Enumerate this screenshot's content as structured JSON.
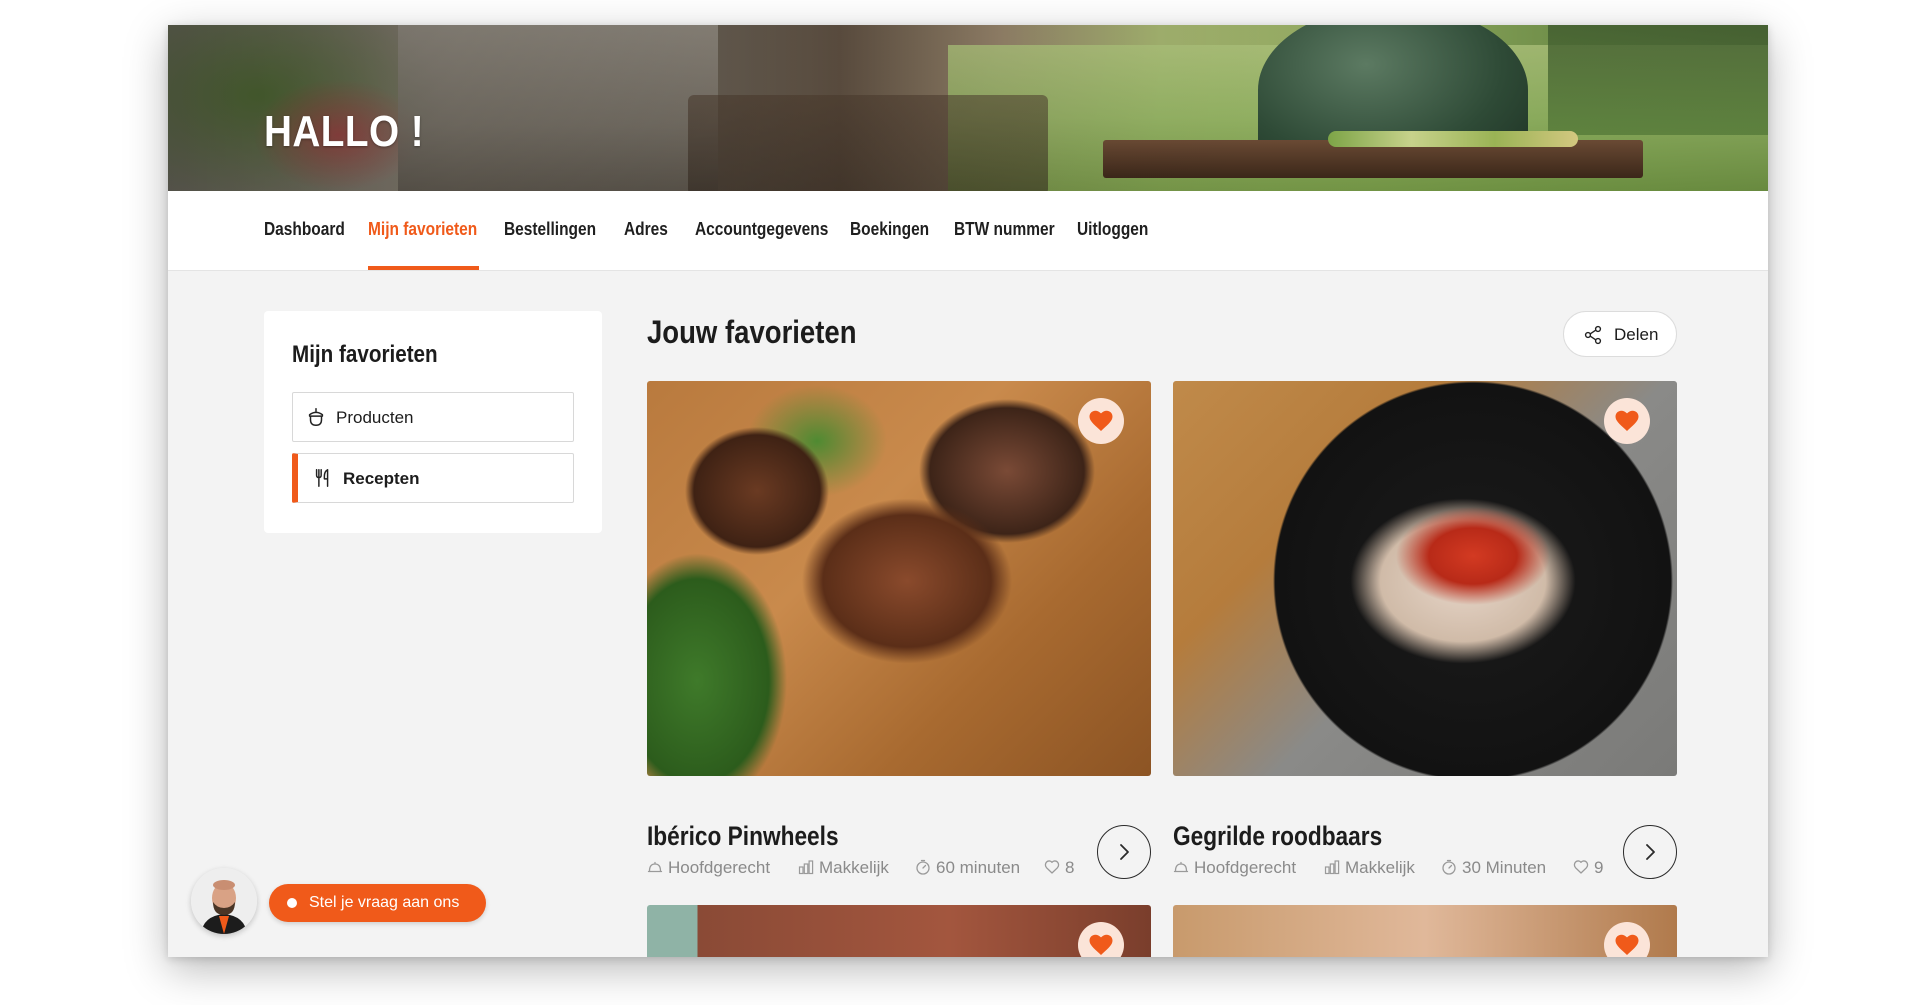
{
  "hero": {
    "title": "HALLO !"
  },
  "nav": {
    "items": [
      {
        "label": "Dashboard"
      },
      {
        "label": "Mijn favorieten",
        "active": true
      },
      {
        "label": "Bestellingen"
      },
      {
        "label": "Adres"
      },
      {
        "label": "Accountgegevens"
      },
      {
        "label": "Boekingen"
      },
      {
        "label": "BTW nummer"
      },
      {
        "label": "Uitloggen"
      }
    ]
  },
  "sidebar": {
    "title": "Mijn favorieten",
    "items": [
      {
        "label": "Producten",
        "icon": "acorn-icon"
      },
      {
        "label": "Recepten",
        "icon": "cutlery-icon",
        "active": true
      }
    ]
  },
  "main": {
    "title": "Jouw favorieten",
    "share_label": "Delen",
    "recipes": [
      {
        "title": "Ibérico Pinwheels",
        "course": "Hoofdgerecht",
        "difficulty": "Makkelijk",
        "time": "60 minuten",
        "likes": "8"
      },
      {
        "title": "Gegrilde roodbaars",
        "course": "Hoofdgerecht",
        "difficulty": "Makkelijk",
        "time": "30 Minuten",
        "likes": "9"
      }
    ]
  },
  "chat": {
    "label": "Stel je vraag aan ons"
  },
  "colors": {
    "accent": "#f05a1a",
    "background": "#f3f3f3",
    "heart_bg": "#fbe4d8"
  }
}
